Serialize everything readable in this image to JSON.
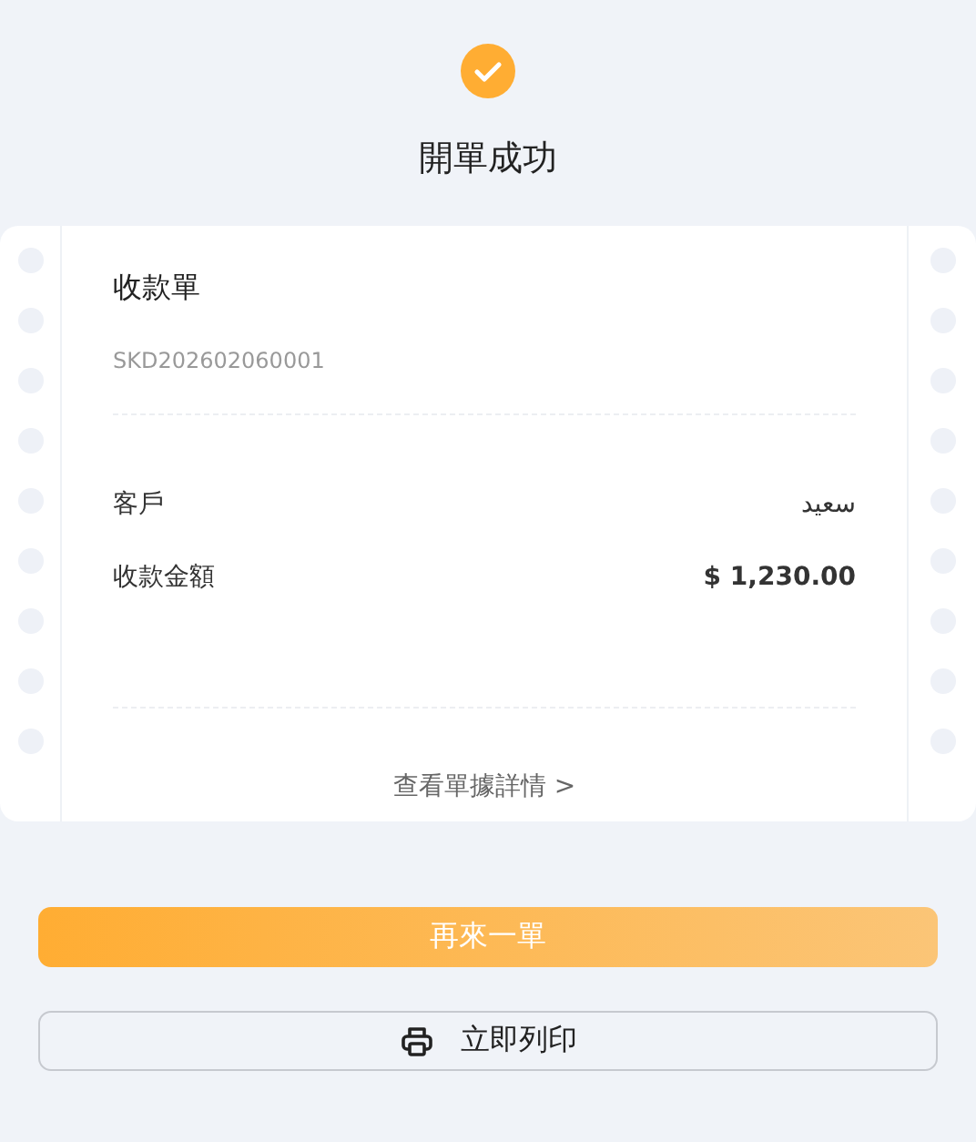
{
  "status": {
    "title": "開單成功"
  },
  "receipt": {
    "title": "收款單",
    "number": "SKD202602060001",
    "fields": [
      {
        "label": "客戶",
        "value": "سعيد",
        "kind": "text"
      },
      {
        "label": "收款金額",
        "value": "$ 1,230.00",
        "kind": "amount"
      }
    ],
    "details_link": "查看單據詳情 >"
  },
  "buttons": [
    {
      "label": "再來一單",
      "kind": "primary"
    },
    {
      "label": "立即列印",
      "kind": "print"
    }
  ]
}
